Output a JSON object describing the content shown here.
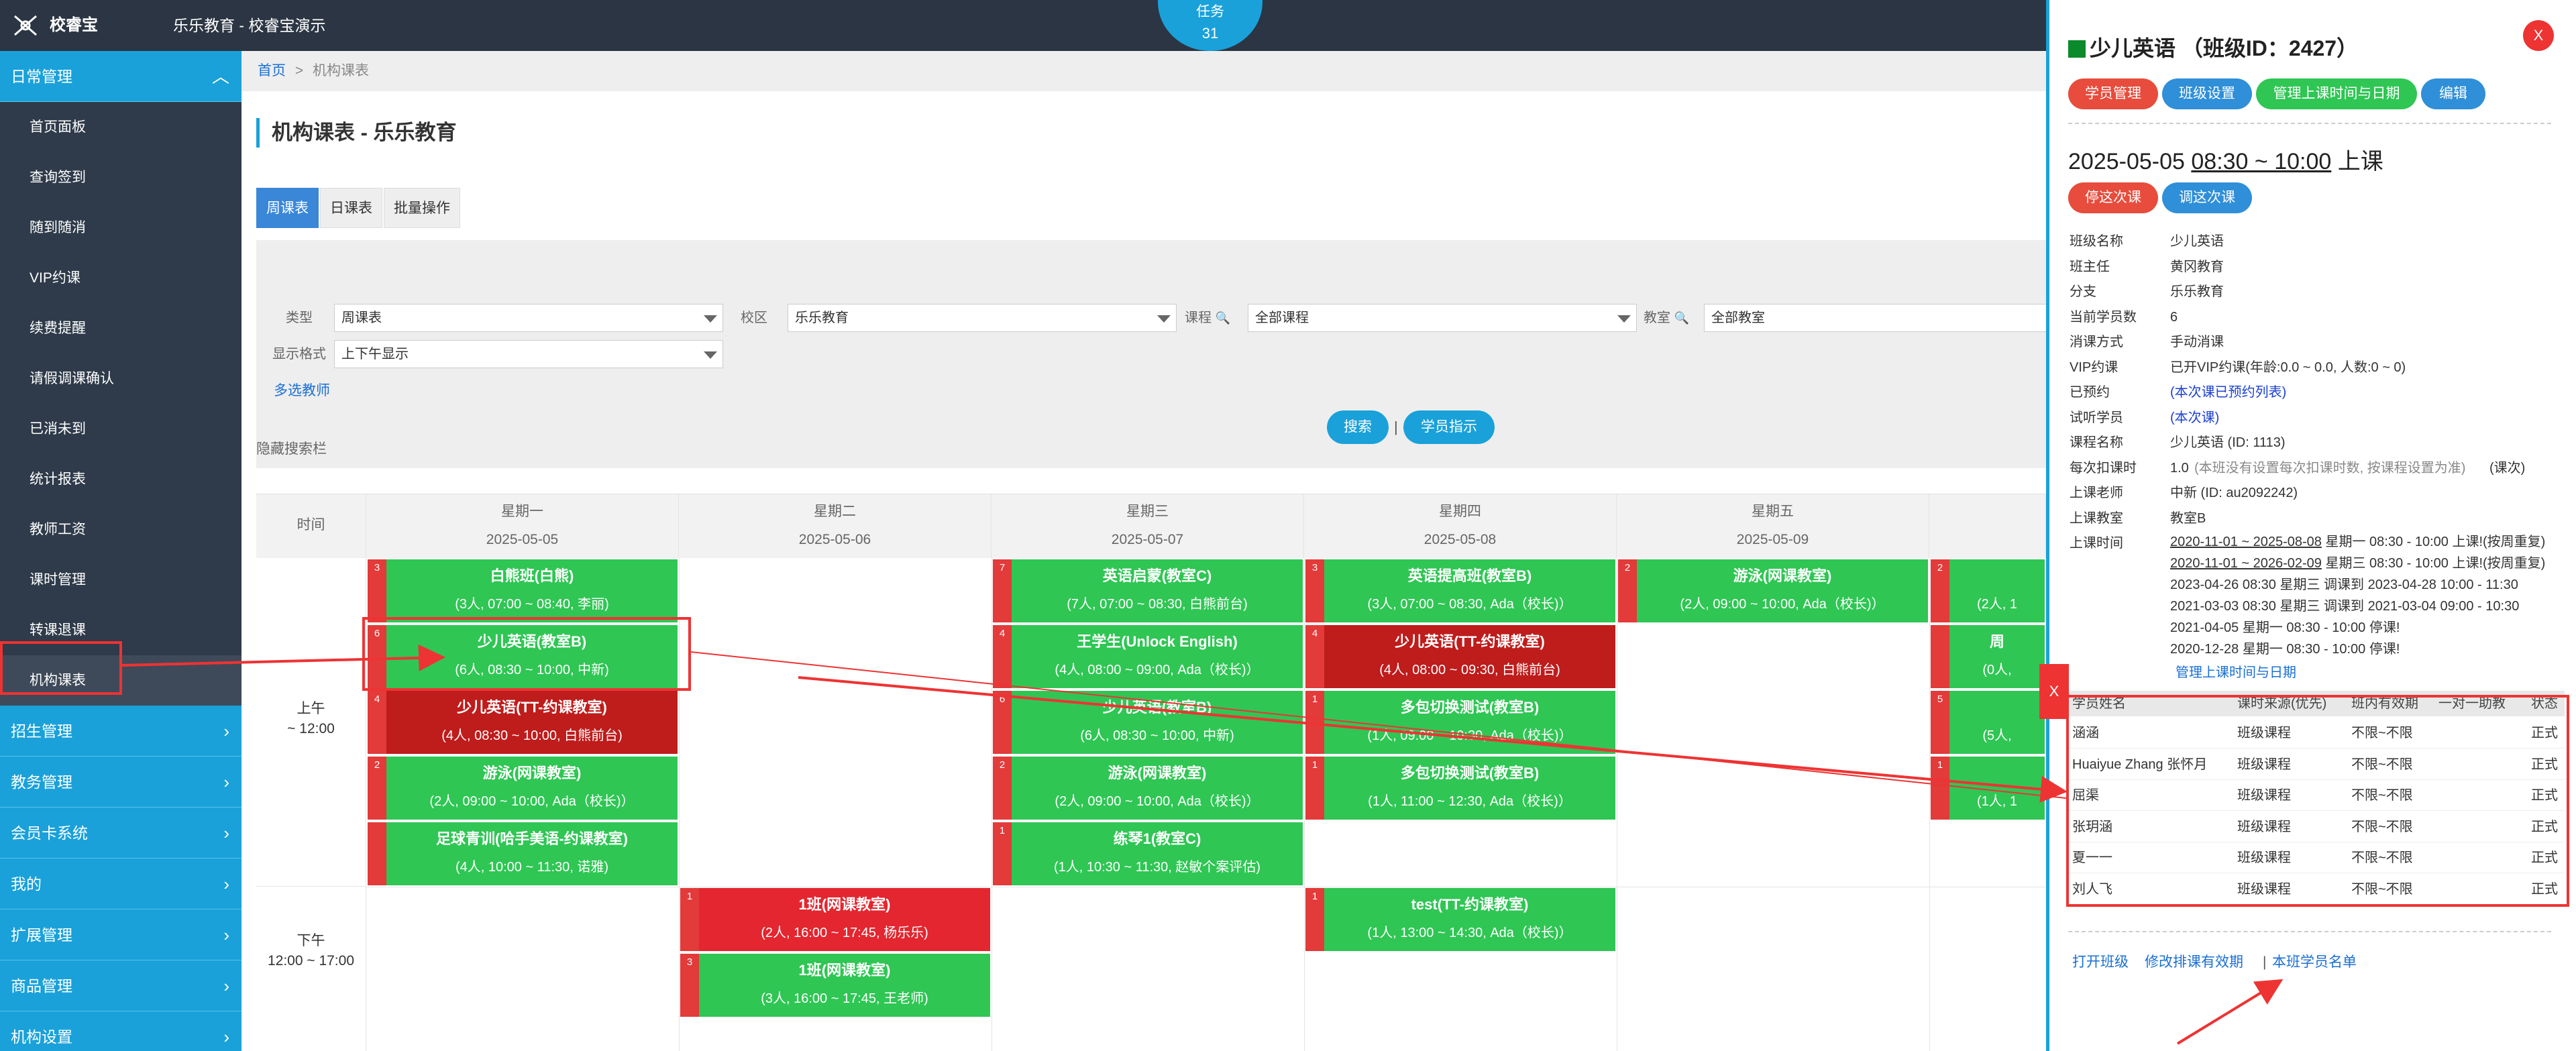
{
  "header": {
    "app_name": "校睿宝",
    "org_name": "乐乐教育 - 校睿宝演示",
    "task_label": "任务",
    "task_count": "31"
  },
  "sidebar": {
    "section_daily": "日常管理",
    "items": [
      "首页面板",
      "查询签到",
      "随到随消",
      "VIP约课",
      "续费提醒",
      "请假调课确认",
      "已消未到",
      "统计报表",
      "教师工资",
      "课时管理",
      "转课退课",
      "机构课表"
    ],
    "sections": [
      "招生管理",
      "教务管理",
      "会员卡系统",
      "我的",
      "扩展管理",
      "商品管理",
      "机构设置"
    ]
  },
  "main": {
    "breadcrumb_home": "首页",
    "breadcrumb_sep": ">",
    "breadcrumb_current": "机构课表",
    "page_title": "机构课表 - 乐乐教育",
    "tabs": [
      "周课表",
      "日课表",
      "批量操作"
    ],
    "filters": {
      "type_label": "类型",
      "type_value": "周课表",
      "campus_label": "校区",
      "campus_value": "乐乐教育",
      "course_label": "课程",
      "course_value": "全部课程",
      "room_label": "教室",
      "room_value": "全部教室",
      "format_label": "显示格式",
      "format_value": "上下午显示",
      "multi_teacher": "多选教师",
      "search_btn": "搜索",
      "sep": "|",
      "student_btn": "学员指示"
    },
    "hide_search": "隐藏搜索栏",
    "time_header": "时间",
    "days": [
      {
        "name": "星期一",
        "date": "2025-05-05"
      },
      {
        "name": "星期二",
        "date": "2025-05-06"
      },
      {
        "name": "星期三",
        "date": "2025-05-07"
      },
      {
        "name": "星期四",
        "date": "2025-05-08"
      },
      {
        "name": "星期五",
        "date": "2025-05-09"
      }
    ],
    "periods": [
      {
        "label": "上午",
        "range": "~ 12:00"
      },
      {
        "label": "下午",
        "range": "12:00 ~ 17:00"
      }
    ],
    "classes": [
      {
        "day": 0,
        "row": 0,
        "badge": "3",
        "name": "白熊班(白熊)",
        "info": "(3人, 07:00 ~ 08:40, 李丽)",
        "color": "g"
      },
      {
        "day": 0,
        "row": 1,
        "badge": "6",
        "name": "少儿英语(教室B)",
        "info": "(6人, 08:30 ~ 10:00, 中新)",
        "color": "g"
      },
      {
        "day": 0,
        "row": 2,
        "badge": "4",
        "name": "少儿英语(TT-约课教室)",
        "info": "(4人, 08:30 ~ 10:00, 白熊前台)",
        "color": "r"
      },
      {
        "day": 0,
        "row": 3,
        "badge": "2",
        "name": "游泳(网课教室)",
        "info": "(2人, 09:00 ~ 10:00, Ada（校长)）",
        "color": "g"
      },
      {
        "day": 0,
        "row": 4,
        "badge": "",
        "name": "足球青训(哈手美语-约课教室)",
        "info": "(4人, 10:00 ~ 11:30, 诺雅)",
        "color": "g"
      },
      {
        "day": 2,
        "row": 0,
        "badge": "7",
        "name": "英语启蒙(教室C)",
        "info": "(7人, 07:00 ~ 08:30, 白熊前台)",
        "color": "g"
      },
      {
        "day": 2,
        "row": 1,
        "badge": "4",
        "name": "王学生(Unlock English)",
        "info": "(4人, 08:00 ~ 09:00, Ada（校长)）",
        "color": "g"
      },
      {
        "day": 2,
        "row": 2,
        "badge": "6",
        "name": "少儿英语(教室B)",
        "info": "(6人, 08:30 ~ 10:00, 中新)",
        "color": "g"
      },
      {
        "day": 2,
        "row": 3,
        "badge": "2",
        "name": "游泳(网课教室)",
        "info": "(2人, 09:00 ~ 10:00, Ada（校长)）",
        "color": "g"
      },
      {
        "day": 2,
        "row": 4,
        "badge": "1",
        "name": "练琴1(教室C)",
        "info": "(1人, 10:30 ~ 11:30, 赵敏个案评估)",
        "color": "g"
      },
      {
        "day": 3,
        "row": 0,
        "badge": "3",
        "name": "英语提高班(教室B)",
        "info": "(3人, 07:00 ~ 08:30, Ada（校长)）",
        "color": "g"
      },
      {
        "day": 3,
        "row": 1,
        "badge": "4",
        "name": "少儿英语(TT-约课教室)",
        "info": "(4人, 08:00 ~ 09:30, 白熊前台)",
        "color": "r"
      },
      {
        "day": 3,
        "row": 2,
        "badge": "1",
        "name": "多包切换测试(教室B)",
        "info": "(1人, 09:00 ~ 10:30, Ada（校长)）",
        "color": "g"
      },
      {
        "day": 3,
        "row": 3,
        "badge": "1",
        "name": "多包切换测试(教室B)",
        "info": "(1人, 11:00 ~ 12:30, Ada（校长)）",
        "color": "g"
      },
      {
        "day": 4,
        "row": 0,
        "badge": "2",
        "name": "游泳(网课教室)",
        "info": "(2人, 09:00 ~ 10:00, Ada（校长)）",
        "color": "g"
      },
      {
        "day": 1,
        "row": 5,
        "badge": "1",
        "name": "1班(网课教室)",
        "info": "(2人, 16:00 ~ 17:45, 杨乐乐)",
        "color": "rr"
      },
      {
        "day": 1,
        "row": 6,
        "badge": "3",
        "name": "1班(网课教室)",
        "info": "(3人, 16:00 ~ 17:45, 王老师)",
        "color": "g"
      },
      {
        "day": 3,
        "row": 5,
        "badge": "1",
        "name": "test(TT-约课教室)",
        "info": "(1人, 13:00 ~ 14:30, Ada（校长)）",
        "color": "g"
      },
      {
        "day": 5,
        "row": 0,
        "badge": "2",
        "name": "",
        "info": "(2人, 1",
        "color": "g"
      },
      {
        "day": 5,
        "row": 1,
        "badge": "",
        "name": "周",
        "info": "(0人,",
        "color": "g"
      },
      {
        "day": 5,
        "row": 2,
        "badge": "5",
        "name": "",
        "info": "(5人,",
        "color": "g"
      },
      {
        "day": 5,
        "row": 3,
        "badge": "1",
        "name": "",
        "info": "(1人, 1",
        "color": "g"
      }
    ]
  },
  "panel": {
    "close": "X",
    "title": "少儿英语 （班级ID：2427）",
    "buttons": [
      "学员管理",
      "班级设置",
      "管理上课时间与日期",
      "编辑"
    ],
    "lesson_date": "2025-05-05",
    "lesson_time": "08:30 ~ 10:00",
    "lesson_suffix": "上课",
    "lesson_buttons": [
      "停这次课",
      "调这次课"
    ],
    "info": [
      {
        "k": "班级名称",
        "v": "少儿英语"
      },
      {
        "k": "班主任",
        "v": "黄冈教育"
      },
      {
        "k": "分支",
        "v": "乐乐教育"
      },
      {
        "k": "当前学员数",
        "v": "6"
      },
      {
        "k": "消课方式",
        "v": "手动消课"
      },
      {
        "k": "VIP约课",
        "v": "已开VIP约课(年龄:0.0 ~ 0.0, 人数:0 ~ 0)"
      },
      {
        "k": "已预约",
        "v": "(本次课已预约列表)"
      },
      {
        "k": "试听学员",
        "v": "(本次课)"
      },
      {
        "k": "课程名称",
        "v": "少儿英语 (ID: 1113)"
      },
      {
        "k": "每次扣课时",
        "v": "1.0"
      },
      {
        "k": "上课老师",
        "v": "中新 (ID: au2092242)"
      },
      {
        "k": "上课教室",
        "v": "教室B"
      },
      {
        "k": "上课时间",
        "v": ""
      }
    ],
    "deduct_note": "(本班没有设置每次扣课时数, 按课程设置为准)",
    "deduct_unit": "(课次)",
    "time_lines": [
      {
        "u": "2020-11-01 ~ 2025-08-08",
        "t": " 星期一 08:30 - 10:00 上课!(按周重复)"
      },
      {
        "u": "2020-11-01 ~ 2026-02-09",
        "t": " 星期三 08:30 - 10:00 上课!(按周重复)"
      },
      {
        "u": "",
        "t": "2023-04-26 08:30 星期三 调课到 2023-04-28 10:00 - 11:30"
      },
      {
        "u": "",
        "t": "2021-03-03 08:30 星期三 调课到 2021-03-04 09:00 - 10:30"
      },
      {
        "u": "",
        "t": "2021-04-05 星期一 08:30 - 10:00 停课!"
      },
      {
        "u": "",
        "t": "2020-12-28 星期一 08:30 - 10:00 停课!"
      }
    ],
    "manage_time_link": "管理上课时间与日期",
    "students_headers": [
      "学员姓名",
      "课时来源(优先)",
      "班内有效期",
      "一对一助教",
      "状态"
    ],
    "students": [
      [
        "涵涵",
        "班级课程",
        "不限~不限",
        "",
        "正式"
      ],
      [
        "Huaiyue Zhang 张怀月",
        "班级课程",
        "不限~不限",
        "",
        "正式"
      ],
      [
        "屈渠",
        "班级课程",
        "不限~不限",
        "",
        "正式"
      ],
      [
        "张玥涵",
        "班级课程",
        "不限~不限",
        "",
        "正式"
      ],
      [
        "夏一一",
        "班级课程",
        "不限~不限",
        "",
        "正式"
      ],
      [
        "刘人飞",
        "班级课程",
        "不限~不限",
        "",
        "正式"
      ]
    ],
    "bottom_links": [
      "打开班级",
      "修改排课有效期",
      "本班学员名单"
    ],
    "bottom_sep": "|",
    "side_x": "X"
  },
  "colors": {
    "accent": "#1aa1d9",
    "green": "#2fc654",
    "dark_red": "#bf1c1c",
    "red": "#e33",
    "header": "#2b3543",
    "sidebar": "#2f3b4a"
  }
}
